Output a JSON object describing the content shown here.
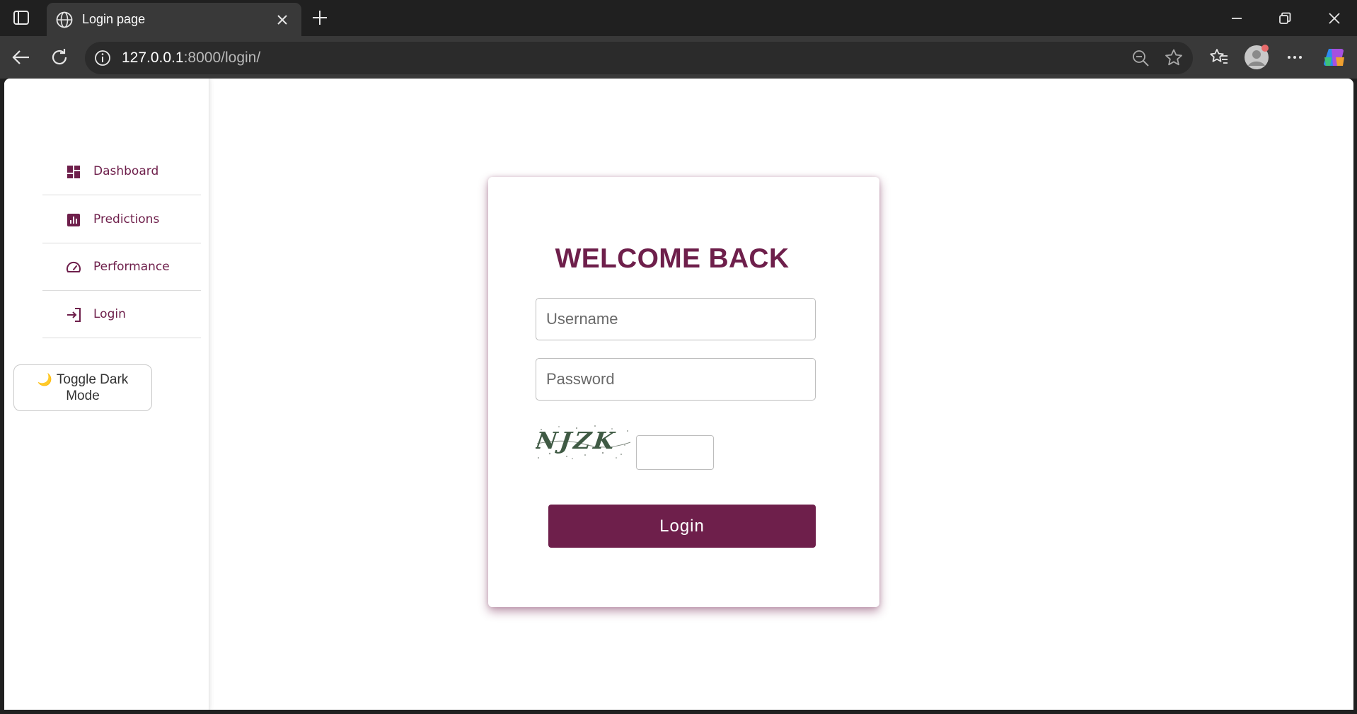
{
  "browser": {
    "tab_title": "Login page",
    "url_host": "127.0.0.1",
    "url_rest": ":8000/login/"
  },
  "sidebar": {
    "items": [
      {
        "label": "Dashboard",
        "icon": "dashboard-icon"
      },
      {
        "label": "Predictions",
        "icon": "bar-chart-icon"
      },
      {
        "label": "Performance",
        "icon": "speedometer-icon"
      },
      {
        "label": "Login",
        "icon": "login-arrow-icon"
      }
    ],
    "toggle_icon": "🌙",
    "toggle_label": "Toggle Dark Mode"
  },
  "login_form": {
    "title": "WELCOME BACK",
    "username_placeholder": "Username",
    "password_placeholder": "Password",
    "captcha_text": "NJZK",
    "captcha_value": "",
    "submit_label": "Login"
  },
  "colors": {
    "accent": "#6e1f4b",
    "chrome_dark": "#202020",
    "chrome_tab": "#393939"
  }
}
